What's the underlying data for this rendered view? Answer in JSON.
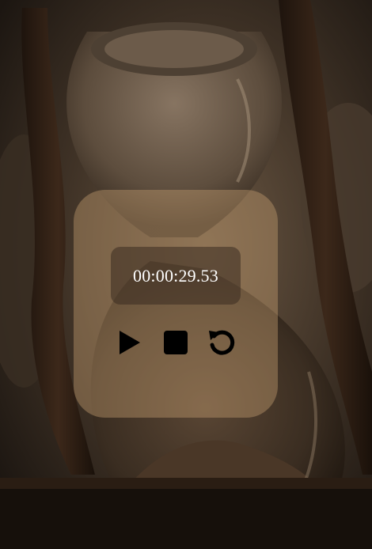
{
  "stopwatch": {
    "time": "00:00:29.53"
  },
  "controls": {
    "play_icon": "play-icon",
    "stop_icon": "stop-icon",
    "reset_icon": "reset-icon"
  },
  "colors": {
    "panel": "#c49e70",
    "time_box": "#3a2c20",
    "icon": "#000000",
    "time_text": "#ffffff"
  }
}
